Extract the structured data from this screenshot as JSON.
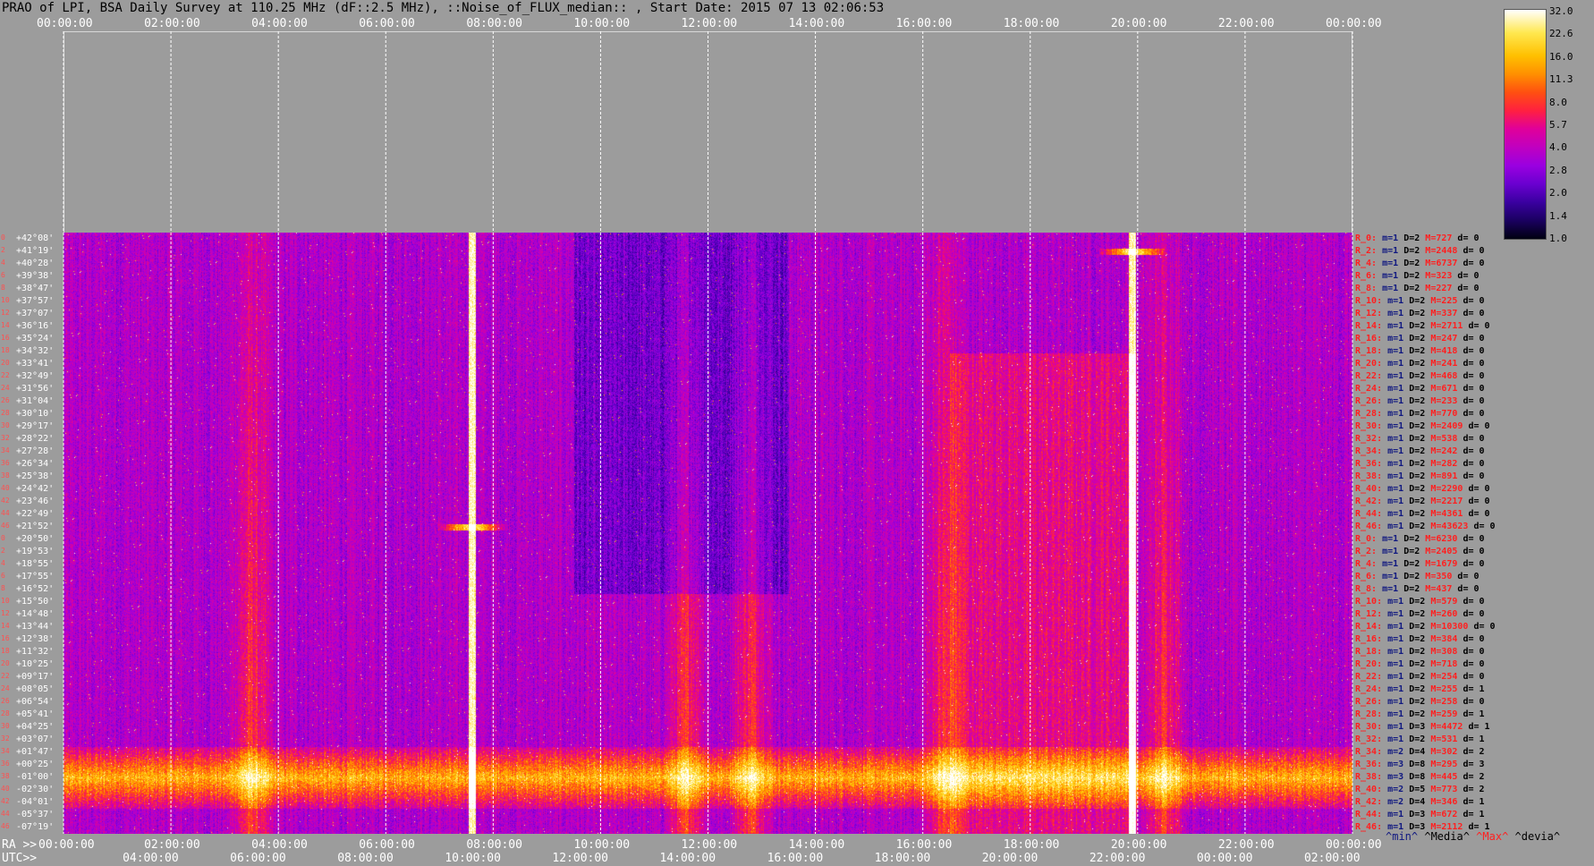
{
  "title": "PRAO of LPI, BSA Daily Survey at 110.25 MHz (dF::2.5 MHz), ::Noise_of_FLUX_median:: , Start Date: 2015 07 13 02:06:53",
  "chart_data": {
    "type": "heatmap",
    "title": "PRAO of LPI, BSA Daily Survey at 110.25 MHz (dF::2.5 MHz), ::Noise_of_FLUX_median:: , Start Date: 2015 07 13 02:06:53",
    "x_top_ticks": [
      "00:00:00",
      "02:00:00",
      "04:00:00",
      "06:00:00",
      "08:00:00",
      "10:00:00",
      "12:00:00",
      "14:00:00",
      "16:00:00",
      "18:00:00",
      "20:00:00",
      "22:00:00",
      "00:00:00"
    ],
    "x_bottom_ra_label": "RA >>",
    "x_bottom_ra_ticks": [
      "00:00:00",
      "02:00:00",
      "04:00:00",
      "06:00:00",
      "08:00:00",
      "10:00:00",
      "12:00:00",
      "14:00:00",
      "16:00:00",
      "18:00:00",
      "20:00:00",
      "22:00:00",
      "00:00:00"
    ],
    "x_bottom_utc_label": "UTC>>",
    "x_bottom_utc_ticks": [
      "04:00:00",
      "06:00:00",
      "08:00:00",
      "10:00:00",
      "12:00:00",
      "14:00:00",
      "16:00:00",
      "18:00:00",
      "20:00:00",
      "22:00:00",
      "00:00:00",
      "02:00:00"
    ],
    "y_labels": [
      "+42°08'",
      "+41°19'",
      "+40°28'",
      "+39°38'",
      "+38°47'",
      "+37°57'",
      "+37°07'",
      "+36°16'",
      "+35°24'",
      "+34°32'",
      "+33°41'",
      "+32°49'",
      "+31°56'",
      "+31°04'",
      "+30°10'",
      "+29°17'",
      "+28°22'",
      "+27°28'",
      "+26°34'",
      "+25°38'",
      "+24°42'",
      "+23°46'",
      "+22°49'",
      "+21°52'",
      "+20°50'",
      "+19°53'",
      "+18°55'",
      "+17°55'",
      "+16°52'",
      "+15°50'",
      "+14°48'",
      "+13°44'",
      "+12°38'",
      "+11°32'",
      "+10°25'",
      "+09°17'",
      "+08°05'",
      "+06°54'",
      "+05°41'",
      "+04°25'",
      "+03°07'",
      "+01°47'",
      "+00°25'",
      "-01°00'",
      "-02°30'",
      "-04°01'",
      "-05°37'",
      "-07°19'"
    ],
    "row_index": [
      "0",
      "2",
      "4",
      "6",
      "8",
      "10",
      "12",
      "14",
      "16",
      "18",
      "20",
      "22",
      "24",
      "26",
      "28",
      "30",
      "32",
      "34",
      "36",
      "38",
      "40",
      "42",
      "44",
      "46",
      "0",
      "2",
      "4",
      "6",
      "8",
      "10",
      "12",
      "14",
      "16",
      "18",
      "20",
      "22",
      "24",
      "26",
      "28",
      "30",
      "32",
      "34",
      "36",
      "38",
      "40",
      "42",
      "44",
      "46"
    ],
    "colorbar_ticks": [
      "32.0",
      "22.6",
      "16.0",
      "11.3",
      "8.0",
      "5.7",
      "4.0",
      "2.8",
      "2.0",
      "1.4",
      "1.0"
    ],
    "colorbar_log": true,
    "row_stats": [
      {
        "r": "R_0:",
        "m": "m=1",
        "D": "D=2",
        "M": "M=727",
        "d": "d= 0"
      },
      {
        "r": "R_2:",
        "m": "m=1",
        "D": "D=2",
        "M": "M=2448",
        "d": "d= 0"
      },
      {
        "r": "R_4:",
        "m": "m=1",
        "D": "D=2",
        "M": "M=6737",
        "d": "d= 0"
      },
      {
        "r": "R_6:",
        "m": "m=1",
        "D": "D=2",
        "M": "M=323",
        "d": "d= 0"
      },
      {
        "r": "R_8:",
        "m": "m=1",
        "D": "D=2",
        "M": "M=227",
        "d": "d= 0"
      },
      {
        "r": "R_10:",
        "m": "m=1",
        "D": "D=2",
        "M": "M=225",
        "d": "d= 0"
      },
      {
        "r": "R_12:",
        "m": "m=1",
        "D": "D=2",
        "M": "M=337",
        "d": "d= 0"
      },
      {
        "r": "R_14:",
        "m": "m=1",
        "D": "D=2",
        "M": "M=2711",
        "d": "d= 0"
      },
      {
        "r": "R_16:",
        "m": "m=1",
        "D": "D=2",
        "M": "M=247",
        "d": "d= 0"
      },
      {
        "r": "R_18:",
        "m": "m=1",
        "D": "D=2",
        "M": "M=418",
        "d": "d= 0"
      },
      {
        "r": "R_20:",
        "m": "m=1",
        "D": "D=2",
        "M": "M=241",
        "d": "d= 0"
      },
      {
        "r": "R_22:",
        "m": "m=1",
        "D": "D=2",
        "M": "M=468",
        "d": "d= 0"
      },
      {
        "r": "R_24:",
        "m": "m=1",
        "D": "D=2",
        "M": "M=671",
        "d": "d= 0"
      },
      {
        "r": "R_26:",
        "m": "m=1",
        "D": "D=2",
        "M": "M=233",
        "d": "d= 0"
      },
      {
        "r": "R_28:",
        "m": "m=1",
        "D": "D=2",
        "M": "M=770",
        "d": "d= 0"
      },
      {
        "r": "R_30:",
        "m": "m=1",
        "D": "D=2",
        "M": "M=2409",
        "d": "d= 0"
      },
      {
        "r": "R_32:",
        "m": "m=1",
        "D": "D=2",
        "M": "M=538",
        "d": "d= 0"
      },
      {
        "r": "R_34:",
        "m": "m=1",
        "D": "D=2",
        "M": "M=242",
        "d": "d= 0"
      },
      {
        "r": "R_36:",
        "m": "m=1",
        "D": "D=2",
        "M": "M=282",
        "d": "d= 0"
      },
      {
        "r": "R_38:",
        "m": "m=1",
        "D": "D=2",
        "M": "M=891",
        "d": "d= 0"
      },
      {
        "r": "R_40:",
        "m": "m=1",
        "D": "D=2",
        "M": "M=2290",
        "d": "d= 0"
      },
      {
        "r": "R_42:",
        "m": "m=1",
        "D": "D=2",
        "M": "M=2217",
        "d": "d= 0"
      },
      {
        "r": "R_44:",
        "m": "m=1",
        "D": "D=2",
        "M": "M=4361",
        "d": "d= 0"
      },
      {
        "r": "R_46:",
        "m": "m=1",
        "D": "D=2",
        "M": "M=43623",
        "d": "d= 0"
      },
      {
        "r": "R_0:",
        "m": "m=1",
        "D": "D=2",
        "M": "M=6230",
        "d": "d= 0"
      },
      {
        "r": "R_2:",
        "m": "m=1",
        "D": "D=2",
        "M": "M=2405",
        "d": "d= 0"
      },
      {
        "r": "R_4:",
        "m": "m=1",
        "D": "D=2",
        "M": "M=1679",
        "d": "d= 0"
      },
      {
        "r": "R_6:",
        "m": "m=1",
        "D": "D=2",
        "M": "M=350",
        "d": "d= 0"
      },
      {
        "r": "R_8:",
        "m": "m=1",
        "D": "D=2",
        "M": "M=437",
        "d": "d= 0"
      },
      {
        "r": "R_10:",
        "m": "m=1",
        "D": "D=2",
        "M": "M=579",
        "d": "d= 0"
      },
      {
        "r": "R_12:",
        "m": "m=1",
        "D": "D=2",
        "M": "M=260",
        "d": "d= 0"
      },
      {
        "r": "R_14:",
        "m": "m=1",
        "D": "D=2",
        "M": "M=10300",
        "d": "d= 0"
      },
      {
        "r": "R_16:",
        "m": "m=1",
        "D": "D=2",
        "M": "M=384",
        "d": "d= 0"
      },
      {
        "r": "R_18:",
        "m": "m=1",
        "D": "D=2",
        "M": "M=308",
        "d": "d= 0"
      },
      {
        "r": "R_20:",
        "m": "m=1",
        "D": "D=2",
        "M": "M=718",
        "d": "d= 0"
      },
      {
        "r": "R_22:",
        "m": "m=1",
        "D": "D=2",
        "M": "M=254",
        "d": "d= 0"
      },
      {
        "r": "R_24:",
        "m": "m=1",
        "D": "D=2",
        "M": "M=255",
        "d": "d= 1"
      },
      {
        "r": "R_26:",
        "m": "m=1",
        "D": "D=2",
        "M": "M=258",
        "d": "d= 0"
      },
      {
        "r": "R_28:",
        "m": "m=1",
        "D": "D=2",
        "M": "M=259",
        "d": "d= 1"
      },
      {
        "r": "R_30:",
        "m": "m=1",
        "D": "D=3",
        "M": "M=4472",
        "d": "d= 1"
      },
      {
        "r": "R_32:",
        "m": "m=1",
        "D": "D=2",
        "M": "M=531",
        "d": "d= 1"
      },
      {
        "r": "R_34:",
        "m": "m=2",
        "D": "D=4",
        "M": "M=302",
        "d": "d= 2"
      },
      {
        "r": "R_36:",
        "m": "m=3",
        "D": "D=8",
        "M": "M=295",
        "d": "d= 3"
      },
      {
        "r": "R_38:",
        "m": "m=3",
        "D": "D=8",
        "M": "M=445",
        "d": "d= 2"
      },
      {
        "r": "R_40:",
        "m": "m=2",
        "D": "D=5",
        "M": "M=773",
        "d": "d= 2"
      },
      {
        "r": "R_42:",
        "m": "m=2",
        "D": "D=4",
        "M": "M=346",
        "d": "d= 1"
      },
      {
        "r": "R_44:",
        "m": "m=1",
        "D": "D=3",
        "M": "M=672",
        "d": "d= 1"
      },
      {
        "r": "R_46:",
        "m": "m=1",
        "D": "D=3",
        "M": "M=2112",
        "d": "d= 1"
      }
    ],
    "stat_legend": {
      "min": "^min^",
      "median": "^Media^",
      "max": "^Max^",
      "dev": "^devia^"
    },
    "features": {
      "bright_source_ra_hours": [
        7.6,
        19.9
      ],
      "bright_source_dec_rows": [
        23,
        1
      ],
      "equatorial_band_rows": [
        41,
        45
      ],
      "broadband_ra_hours": [
        3.5,
        11.6,
        12.8,
        16.4,
        20.5
      ]
    }
  }
}
